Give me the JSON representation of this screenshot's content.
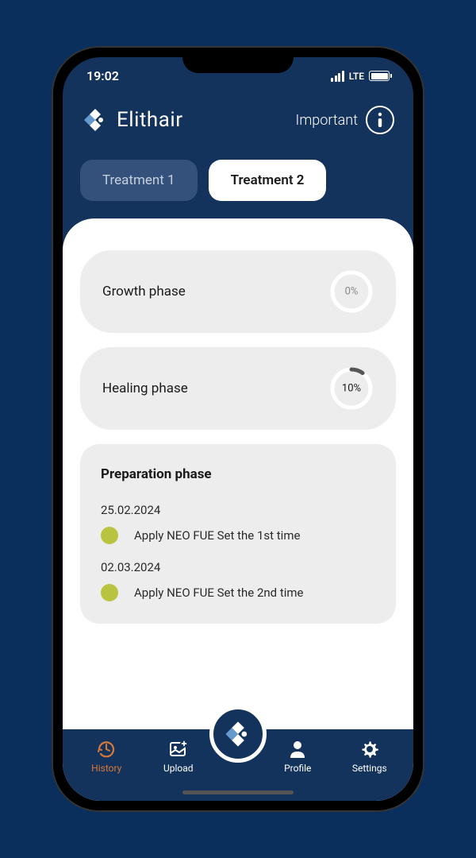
{
  "status_bar": {
    "time": "19:02",
    "network": "LTE"
  },
  "header": {
    "brand": "Elithair",
    "important_label": "Important"
  },
  "tabs": [
    {
      "label": "Treatment 1",
      "active": false
    },
    {
      "label": "Treatment 2",
      "active": true
    }
  ],
  "phases": {
    "growth": {
      "label": "Growth phase",
      "percent": "0%",
      "value": 0
    },
    "healing": {
      "label": "Healing phase",
      "percent": "10%",
      "value": 10
    }
  },
  "preparation": {
    "title": "Preparation phase",
    "tasks": [
      {
        "date": "25.02.2024",
        "text": "Apply NEO FUE Set the 1st time"
      },
      {
        "date": "02.03.2024",
        "text": "Apply NEO FUE Set the 2nd time"
      }
    ]
  },
  "nav": {
    "history": "History",
    "upload": "Upload",
    "profile": "Profile",
    "settings": "Settings"
  }
}
